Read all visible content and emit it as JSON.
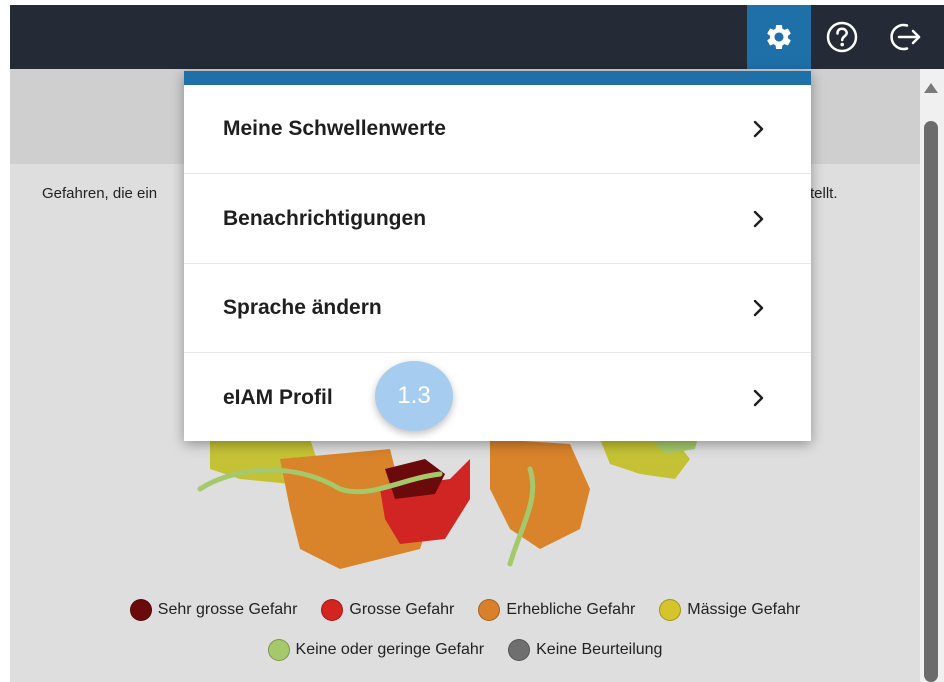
{
  "topbar": {
    "icons": [
      "gear-icon",
      "help-circle-icon",
      "logout-icon"
    ],
    "colors": {
      "bar": "#252b36",
      "active": "#1f6fa8"
    }
  },
  "content": {
    "intro_left": "Gefahren, die ein",
    "intro_right": "tellt."
  },
  "settings_menu": {
    "items": [
      {
        "label": "Meine Schwellenwerte",
        "icon": "chevron-right-icon"
      },
      {
        "label": "Benachrichtigungen",
        "icon": "chevron-right-icon"
      },
      {
        "label": "Sprache ändern",
        "icon": "chevron-right-icon"
      },
      {
        "label": "eIAM Profil",
        "icon": "chevron-right-icon"
      }
    ]
  },
  "step_badge": {
    "label": "1.3"
  },
  "legend": {
    "row1": [
      {
        "label": "Sehr grosse Gefahr",
        "color": "#6b0a0a"
      },
      {
        "label": "Grosse Gefahr",
        "color": "#d42420"
      },
      {
        "label": "Erhebliche Gefahr",
        "color": "#d9802c"
      },
      {
        "label": "Mässige Gefahr",
        "color": "#d6c52a"
      }
    ],
    "row2": [
      {
        "label": "Keine oder geringe Gefahr",
        "color": "#a5c96a"
      },
      {
        "label": "Keine Beurteilung",
        "color": "#6f6f6f"
      }
    ]
  }
}
